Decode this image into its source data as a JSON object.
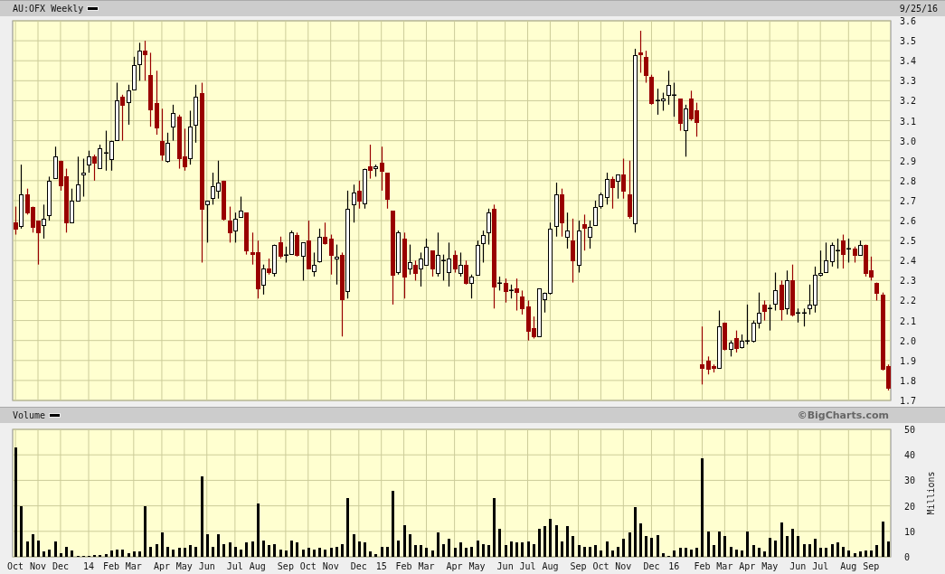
{
  "header": {
    "title": "AU:OFX Weekly",
    "date": "9/25/16"
  },
  "price": {
    "chart_data": {
      "type": "candlestick",
      "grid": true,
      "categories": [
        null,
        null,
        null,
        null,
        null,
        null,
        null,
        null,
        null,
        null,
        null,
        null,
        null,
        null,
        null,
        null,
        null,
        null,
        null,
        null,
        null,
        null,
        null,
        null,
        null,
        null,
        null,
        null,
        null,
        null,
        null,
        null,
        null,
        null,
        null,
        null,
        null,
        null,
        null,
        null,
        null,
        null,
        null,
        null,
        null,
        null,
        null,
        null,
        null,
        null,
        null,
        null,
        null,
        null,
        null,
        null,
        null,
        null,
        null,
        null,
        null,
        null,
        null,
        null,
        null,
        null,
        null,
        null,
        null,
        null,
        null,
        null,
        null,
        null,
        null,
        null,
        null,
        null,
        null,
        null,
        null,
        null,
        null,
        null,
        null,
        null,
        null,
        null,
        null,
        null,
        null,
        null,
        null,
        null,
        null,
        null,
        null,
        null,
        null,
        null,
        null,
        null,
        null,
        null,
        null,
        null,
        null,
        null,
        null,
        null,
        null,
        null,
        null,
        null,
        null,
        null,
        null,
        null,
        null,
        null,
        null,
        null,
        null,
        null,
        null,
        null,
        null,
        null,
        null,
        null,
        null,
        null,
        null,
        null,
        null,
        null,
        null,
        null,
        null,
        null,
        null,
        null,
        null,
        null,
        null,
        null,
        null,
        null,
        null,
        null,
        null,
        null,
        null,
        null,
        null,
        null
      ],
      "ylim": [
        1.7,
        3.6
      ],
      "yticks": [
        1.7,
        1.8,
        1.9,
        {
          "value": 2,
          "label": "2.0"
        },
        2.1,
        2.2,
        2.3,
        2.4,
        2.5,
        2.6,
        2.7,
        2.8,
        2.9,
        {
          "value": 3,
          "label": "3.0"
        },
        3.1,
        3.2,
        3.3,
        3.4,
        3.5,
        3.6
      ],
      "ohlc": [
        [
          2.59,
          2.67,
          2.53,
          2.56
        ],
        [
          2.57,
          2.88,
          2.56,
          2.73
        ],
        [
          2.73,
          2.76,
          2.63,
          2.64
        ],
        [
          2.67,
          2.67,
          2.54,
          2.57
        ],
        [
          2.6,
          2.6,
          2.38,
          2.54
        ],
        [
          2.58,
          2.68,
          2.51,
          2.61
        ],
        [
          2.63,
          2.82,
          2.6,
          2.8
        ],
        [
          2.81,
          2.97,
          2.81,
          2.92
        ],
        [
          2.9,
          2.9,
          2.75,
          2.78
        ],
        [
          2.82,
          2.86,
          2.54,
          2.59
        ],
        [
          2.59,
          2.76,
          2.59,
          2.7
        ],
        [
          2.7,
          2.92,
          2.7,
          2.78
        ],
        [
          2.83,
          2.91,
          2.72,
          2.84
        ],
        [
          2.88,
          2.95,
          2.84,
          2.92
        ],
        [
          2.92,
          2.93,
          2.8,
          2.89
        ],
        [
          2.86,
          2.98,
          2.86,
          2.96
        ],
        [
          2.94,
          3.05,
          2.85,
          2.94
        ],
        [
          2.91,
          3.0,
          2.85,
          3.0
        ],
        [
          3.0,
          3.29,
          3.0,
          3.2
        ],
        [
          3.22,
          3.23,
          3.0,
          3.18
        ],
        [
          3.19,
          3.28,
          3.08,
          3.25
        ],
        [
          3.26,
          3.42,
          3.26,
          3.38
        ],
        [
          3.38,
          3.49,
          3.3,
          3.45
        ],
        [
          3.45,
          3.5,
          3.3,
          3.43
        ],
        [
          3.33,
          3.44,
          3.07,
          3.16
        ],
        [
          3.19,
          3.35,
          3.03,
          3.07
        ],
        [
          3.0,
          3.16,
          2.9,
          2.93
        ],
        [
          2.9,
          3.04,
          2.89,
          2.99
        ],
        [
          3.07,
          3.18,
          3.0,
          3.14
        ],
        [
          3.12,
          3.13,
          2.86,
          2.91
        ],
        [
          2.92,
          3.06,
          2.85,
          2.87
        ],
        [
          2.91,
          3.15,
          2.88,
          3.07
        ],
        [
          3.08,
          3.28,
          2.99,
          3.22
        ],
        [
          3.24,
          3.29,
          2.39,
          2.66
        ],
        [
          2.68,
          2.7,
          2.49,
          2.7
        ],
        [
          2.71,
          2.84,
          2.68,
          2.77
        ],
        [
          2.75,
          2.9,
          2.71,
          2.79
        ],
        [
          2.8,
          2.8,
          2.6,
          2.61
        ],
        [
          2.6,
          2.67,
          2.49,
          2.54
        ],
        [
          2.55,
          2.64,
          2.49,
          2.61
        ],
        [
          2.62,
          2.72,
          2.62,
          2.65
        ],
        [
          2.64,
          2.64,
          2.43,
          2.45
        ],
        [
          2.44,
          2.54,
          2.38,
          2.43
        ],
        [
          2.44,
          2.5,
          2.21,
          2.26
        ],
        [
          2.28,
          2.38,
          2.23,
          2.36
        ],
        [
          2.36,
          2.41,
          2.33,
          2.34
        ],
        [
          2.34,
          2.48,
          2.32,
          2.48
        ],
        [
          2.49,
          2.52,
          2.41,
          2.42
        ],
        [
          2.43,
          2.47,
          2.39,
          2.43
        ],
        [
          2.43,
          2.55,
          2.43,
          2.54
        ],
        [
          2.53,
          2.54,
          2.42,
          2.43
        ],
        [
          2.42,
          2.49,
          2.3,
          2.49
        ],
        [
          2.5,
          2.6,
          2.36,
          2.36
        ],
        [
          2.35,
          2.44,
          2.32,
          2.38
        ],
        [
          2.4,
          2.56,
          2.39,
          2.52
        ],
        [
          2.52,
          2.59,
          2.48,
          2.49
        ],
        [
          2.51,
          2.53,
          2.33,
          2.43
        ],
        [
          2.41,
          2.48,
          2.28,
          2.42
        ],
        [
          2.43,
          2.44,
          2.02,
          2.21
        ],
        [
          2.25,
          2.75,
          2.21,
          2.66
        ],
        [
          2.68,
          2.78,
          2.59,
          2.74
        ],
        [
          2.75,
          2.8,
          2.66,
          2.7
        ],
        [
          2.69,
          2.86,
          2.66,
          2.86
        ],
        [
          2.87,
          2.98,
          2.81,
          2.85
        ],
        [
          2.86,
          2.88,
          2.82,
          2.87
        ],
        [
          2.89,
          2.97,
          2.75,
          2.85
        ],
        [
          2.84,
          2.84,
          2.66,
          2.71
        ],
        [
          2.65,
          2.65,
          2.18,
          2.33
        ],
        [
          2.34,
          2.55,
          2.33,
          2.54
        ],
        [
          2.51,
          2.54,
          2.21,
          2.32
        ],
        [
          2.36,
          2.48,
          2.33,
          2.39
        ],
        [
          2.38,
          2.4,
          2.3,
          2.34
        ],
        [
          2.36,
          2.44,
          2.27,
          2.41
        ],
        [
          2.38,
          2.51,
          2.38,
          2.47
        ],
        [
          2.45,
          2.45,
          2.32,
          2.36
        ],
        [
          2.34,
          2.54,
          2.32,
          2.43
        ],
        [
          2.4,
          2.43,
          2.3,
          2.4
        ],
        [
          2.34,
          2.49,
          2.27,
          2.41
        ],
        [
          2.43,
          2.45,
          2.34,
          2.36
        ],
        [
          2.34,
          2.44,
          2.32,
          2.38
        ],
        [
          2.38,
          2.4,
          2.28,
          2.29
        ],
        [
          2.29,
          2.33,
          2.21,
          2.32
        ],
        [
          2.33,
          2.5,
          2.33,
          2.48
        ],
        [
          2.49,
          2.55,
          2.39,
          2.53
        ],
        [
          2.54,
          2.66,
          2.48,
          2.64
        ],
        [
          2.66,
          2.68,
          2.16,
          2.27
        ],
        [
          2.29,
          2.32,
          2.25,
          2.29
        ],
        [
          2.29,
          2.31,
          2.19,
          2.25
        ],
        [
          2.25,
          2.28,
          2.21,
          2.25
        ],
        [
          2.26,
          2.31,
          2.15,
          2.24
        ],
        [
          2.22,
          2.25,
          2.13,
          2.16
        ],
        [
          2.17,
          2.2,
          2.0,
          2.05
        ],
        [
          2.06,
          2.12,
          2.01,
          2.02
        ],
        [
          2.02,
          2.26,
          2.02,
          2.26
        ],
        [
          2.21,
          2.24,
          2.14,
          2.24
        ],
        [
          2.24,
          2.59,
          2.23,
          2.56
        ],
        [
          2.57,
          2.79,
          2.52,
          2.73
        ],
        [
          2.73,
          2.76,
          2.52,
          2.59
        ],
        [
          2.52,
          2.64,
          2.46,
          2.55
        ],
        [
          2.5,
          2.61,
          2.29,
          2.4
        ],
        [
          2.38,
          2.6,
          2.34,
          2.55
        ],
        [
          2.58,
          2.63,
          2.45,
          2.56
        ],
        [
          2.52,
          2.6,
          2.46,
          2.57
        ],
        [
          2.58,
          2.7,
          2.58,
          2.67
        ],
        [
          2.67,
          2.74,
          2.66,
          2.73
        ],
        [
          2.72,
          2.84,
          2.68,
          2.81
        ],
        [
          2.81,
          2.82,
          2.66,
          2.77
        ],
        [
          2.8,
          2.83,
          2.71,
          2.83
        ],
        [
          2.83,
          2.91,
          2.71,
          2.75
        ],
        [
          2.73,
          2.9,
          2.61,
          2.62
        ],
        [
          2.59,
          3.46,
          2.54,
          3.43
        ],
        [
          3.44,
          3.55,
          3.34,
          3.43
        ],
        [
          3.42,
          3.45,
          3.29,
          3.33
        ],
        [
          3.32,
          3.33,
          3.18,
          3.19
        ],
        [
          3.2,
          3.26,
          3.13,
          3.2
        ],
        [
          3.2,
          3.24,
          3.15,
          3.21
        ],
        [
          3.23,
          3.35,
          3.18,
          3.28
        ],
        [
          3.23,
          3.29,
          3.12,
          3.23
        ],
        [
          3.21,
          3.21,
          3.05,
          3.09
        ],
        [
          3.05,
          3.18,
          2.92,
          3.16
        ],
        [
          3.21,
          3.25,
          3.1,
          3.11
        ],
        [
          3.15,
          3.19,
          3.02,
          3.09
        ],
        [
          1.88,
          2.07,
          1.78,
          1.86
        ],
        [
          1.9,
          1.92,
          1.83,
          1.86
        ],
        [
          1.87,
          1.88,
          1.84,
          1.86
        ],
        [
          1.86,
          2.15,
          1.86,
          2.07
        ],
        [
          2.09,
          2.09,
          1.95,
          1.96
        ],
        [
          1.96,
          2.0,
          1.92,
          1.99
        ],
        [
          2.01,
          2.05,
          1.94,
          1.96
        ],
        [
          1.97,
          2.03,
          1.96,
          2.0
        ],
        [
          2.0,
          2.18,
          1.98,
          2.0
        ],
        [
          2.0,
          2.1,
          1.99,
          2.09
        ],
        [
          2.09,
          2.24,
          2.06,
          2.14
        ],
        [
          2.18,
          2.2,
          2.1,
          2.15
        ],
        [
          2.16,
          2.18,
          2.05,
          2.16
        ],
        [
          2.18,
          2.34,
          2.15,
          2.25
        ],
        [
          2.28,
          2.3,
          2.1,
          2.16
        ],
        [
          2.16,
          2.35,
          2.13,
          2.3
        ],
        [
          2.3,
          2.38,
          2.12,
          2.13
        ],
        [
          2.14,
          2.16,
          2.09,
          2.14
        ],
        [
          2.14,
          2.16,
          2.07,
          2.14
        ],
        [
          2.16,
          2.28,
          2.13,
          2.18
        ],
        [
          2.18,
          2.37,
          2.14,
          2.33
        ],
        [
          2.33,
          2.45,
          2.32,
          2.34
        ],
        [
          2.34,
          2.49,
          2.34,
          2.4
        ],
        [
          2.4,
          2.49,
          2.37,
          2.48
        ],
        [
          2.45,
          2.51,
          2.36,
          2.45
        ],
        [
          2.5,
          2.53,
          2.36,
          2.43
        ],
        [
          2.46,
          2.51,
          2.39,
          2.46
        ],
        [
          2.46,
          2.47,
          2.39,
          2.43
        ],
        [
          2.43,
          2.5,
          2.43,
          2.48
        ],
        [
          2.48,
          2.48,
          2.32,
          2.34
        ],
        [
          2.35,
          2.42,
          2.3,
          2.32
        ],
        [
          2.29,
          2.29,
          2.2,
          2.24
        ],
        [
          2.23,
          2.24,
          1.85,
          1.86
        ],
        [
          1.87,
          1.88,
          1.75,
          1.76
        ]
      ]
    }
  },
  "volume": {
    "label": "Volume",
    "credit": "©BigCharts.com",
    "chart_data": {
      "type": "bar",
      "grid": true,
      "ylabel": "Millions",
      "ylim": [
        0,
        50
      ],
      "categories": [
        "Oct",
        null,
        null,
        null,
        "Nov",
        null,
        null,
        null,
        "Dec",
        null,
        null,
        null,
        null,
        "14",
        null,
        null,
        null,
        "Feb",
        null,
        null,
        null,
        "Mar",
        null,
        null,
        null,
        null,
        "Apr",
        null,
        null,
        null,
        "May",
        null,
        null,
        null,
        "Jun",
        null,
        null,
        null,
        null,
        "Jul",
        null,
        null,
        null,
        "Aug",
        null,
        null,
        null,
        null,
        "Sep",
        null,
        null,
        null,
        "Oct",
        null,
        null,
        null,
        "Nov",
        null,
        null,
        null,
        null,
        "Dec",
        null,
        null,
        null,
        "15",
        null,
        null,
        null,
        "Feb",
        null,
        null,
        null,
        "Mar",
        null,
        null,
        null,
        null,
        "Apr",
        null,
        null,
        null,
        "May",
        null,
        null,
        null,
        null,
        "Jun",
        null,
        null,
        null,
        "Jul",
        null,
        null,
        null,
        "Aug",
        null,
        null,
        null,
        null,
        "Sep",
        null,
        null,
        null,
        "Oct",
        null,
        null,
        null,
        "Nov",
        null,
        null,
        null,
        null,
        "Dec",
        null,
        null,
        null,
        "16",
        null,
        null,
        null,
        null,
        "Feb",
        null,
        null,
        null,
        "Mar",
        null,
        null,
        null,
        "Apr",
        null,
        null,
        null,
        "May",
        null,
        null,
        null,
        null,
        "Jun",
        null,
        null,
        null,
        "Jul",
        null,
        null,
        null,
        null,
        "Aug",
        null,
        null,
        null,
        "Sep",
        null,
        null,
        null
      ],
      "yticks": [
        0,
        10,
        20,
        30,
        40,
        50
      ],
      "values": [
        43,
        20,
        6,
        9,
        6.5,
        2,
        3,
        6,
        1.5,
        4,
        2.5,
        0.5,
        0.3,
        0.5,
        0.7,
        0.7,
        1.2,
        2.5,
        3,
        3,
        1.5,
        2,
        2,
        20,
        4,
        5,
        9.5,
        4,
        3,
        3.5,
        3.5,
        4.5,
        4,
        31.5,
        9,
        4,
        9,
        5,
        5.5,
        4,
        3,
        5.5,
        6,
        21,
        6.5,
        4.5,
        5,
        3,
        2.5,
        6.5,
        5.5,
        3,
        3.5,
        3,
        3.5,
        3,
        3.5,
        4,
        5,
        23,
        9,
        6,
        5.5,
        2,
        1,
        4,
        4,
        26,
        6.5,
        12.5,
        9,
        4.5,
        4.5,
        3.5,
        2.5,
        9.5,
        5,
        7,
        3.5,
        5.5,
        3.5,
        4,
        6.5,
        5,
        4.5,
        23,
        11,
        4.5,
        6,
        5.5,
        5.5,
        6,
        5,
        11,
        12,
        15,
        12.5,
        6,
        12,
        8,
        4.5,
        4,
        4,
        4.5,
        2.5,
        6,
        2.5,
        4,
        7,
        9.5,
        19.5,
        13,
        8,
        7.5,
        8.5,
        1.5,
        0.5,
        2.5,
        3.5,
        3.5,
        3,
        3.5,
        38.5,
        10,
        4.5,
        10,
        8,
        4,
        3,
        2.5,
        10,
        4.5,
        3.5,
        2,
        7.5,
        6.5,
        13.5,
        8,
        11,
        8,
        5,
        5,
        7,
        3.5,
        3.5,
        5,
        5.5,
        4,
        2.5,
        1.5,
        2,
        2.5,
        2.5,
        4.5,
        14,
        6
      ]
    }
  }
}
